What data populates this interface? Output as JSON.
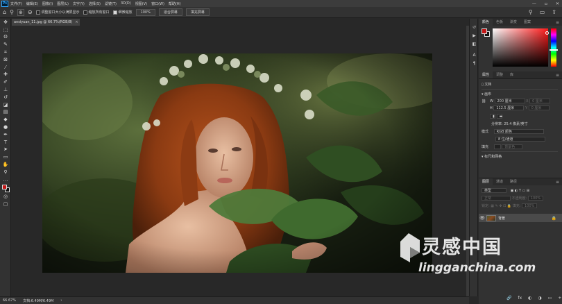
{
  "app": {
    "logo_text": "Ps"
  },
  "menubar": {
    "items": [
      "文件(F)",
      "编辑(E)",
      "图像(I)",
      "图层(L)",
      "文字(Y)",
      "选择(S)",
      "滤镜(T)",
      "3D(D)",
      "视图(V)",
      "窗口(W)",
      "帮助(H)"
    ],
    "window_buttons": [
      "—",
      "▫",
      "✕"
    ]
  },
  "options": {
    "checkbox_resize": "调整窗口大小以满屏显示",
    "checkbox_all_windows": "缩放所有窗口",
    "checkbox_scrubby": "细微缩放",
    "zoom_value": "100%",
    "fit_screen": "适合屏幕",
    "fill_screen": "填充屏幕"
  },
  "document": {
    "tab_title": "ansiyuan_11.jpg @ 66.7%(RGB/8)",
    "close": "×"
  },
  "status": {
    "zoom": "66.67%",
    "doc_info": "文档:6.49M/6.49M"
  },
  "color_panel": {
    "tabs": [
      "颜色",
      "色板",
      "渐变",
      "图案"
    ],
    "fg_color": "#c31616",
    "bg_color": "#111111"
  },
  "properties_panel": {
    "tabs": [
      "属性",
      "调整",
      "库"
    ],
    "doc_label": "文档",
    "canvas_header": "画布",
    "w_label": "W",
    "w_value": "200 厘米",
    "x_label": "X",
    "x_value": "0 厘米",
    "h_label": "H",
    "h_value": "112.5 厘米",
    "y_label": "Y",
    "y_value": "0 厘米",
    "resolution": "分辨率: 25.4 像素/英寸",
    "mode_label": "模式",
    "mode_value": "RGB 颜色",
    "depth_value": "8 位/通道",
    "fill_label": "填充",
    "fill_value": "背景色",
    "rulers_header": "标尺和网格"
  },
  "layers_panel": {
    "tabs": [
      "图层",
      "通道",
      "路径"
    ],
    "kind_filter": "类型",
    "blend_mode": "正常",
    "opacity_label": "不透明度:",
    "opacity_value": "100%",
    "lock_label": "锁定:",
    "fill_label": "填充:",
    "fill_value": "100%",
    "layer_name": "背景",
    "footer_icons": [
      "🔗",
      "fx",
      "◐",
      "◑",
      "▭",
      "+",
      "🗑"
    ]
  },
  "watermark": {
    "chinese": "灵感中国",
    "english": "lingganchina.com"
  },
  "colors": {
    "accent_red": "#c31616",
    "panel_bg": "#323232",
    "canvas_bg": "#282828"
  }
}
